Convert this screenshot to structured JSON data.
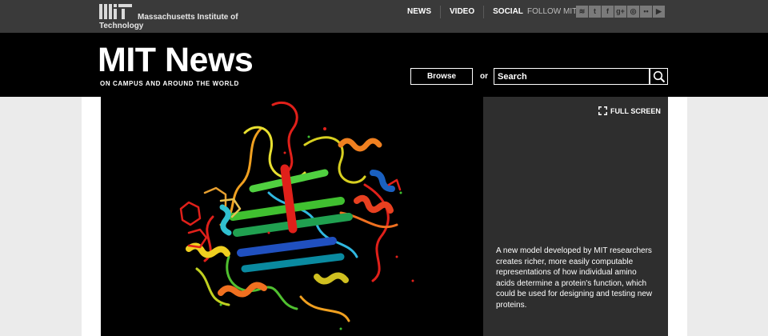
{
  "header_top": {
    "institute_name_line1": "Massachusetts Institute of",
    "institute_name_line2": "Technology",
    "nav": [
      "NEWS",
      "VIDEO",
      "SOCIAL"
    ],
    "follow_label": "FOLLOW MIT",
    "social_icons": [
      "rss-icon",
      "twitter-icon",
      "facebook-icon",
      "google-plus-icon",
      "instagram-icon",
      "flickr-icon",
      "youtube-icon"
    ]
  },
  "masthead": {
    "title": "MIT News",
    "tagline": "ON CAMPUS AND AROUND THE WORLD",
    "browse_label": "Browse",
    "or_label": "or",
    "search_placeholder": "Search"
  },
  "feature": {
    "image_subject": "protein-ribbon-structure",
    "fullscreen_label": "FULL SCREEN",
    "caption": "A new model developed by MIT researchers creates richer, more easily computable representations of how individual amino acids determine a protein's function, which could be used for designing and testing new proteins."
  },
  "colors": {
    "top_bar": "#3a3a3a",
    "masthead": "#000000",
    "caption_panel": "#2e2e2e",
    "page_bg": "#ebebeb"
  }
}
